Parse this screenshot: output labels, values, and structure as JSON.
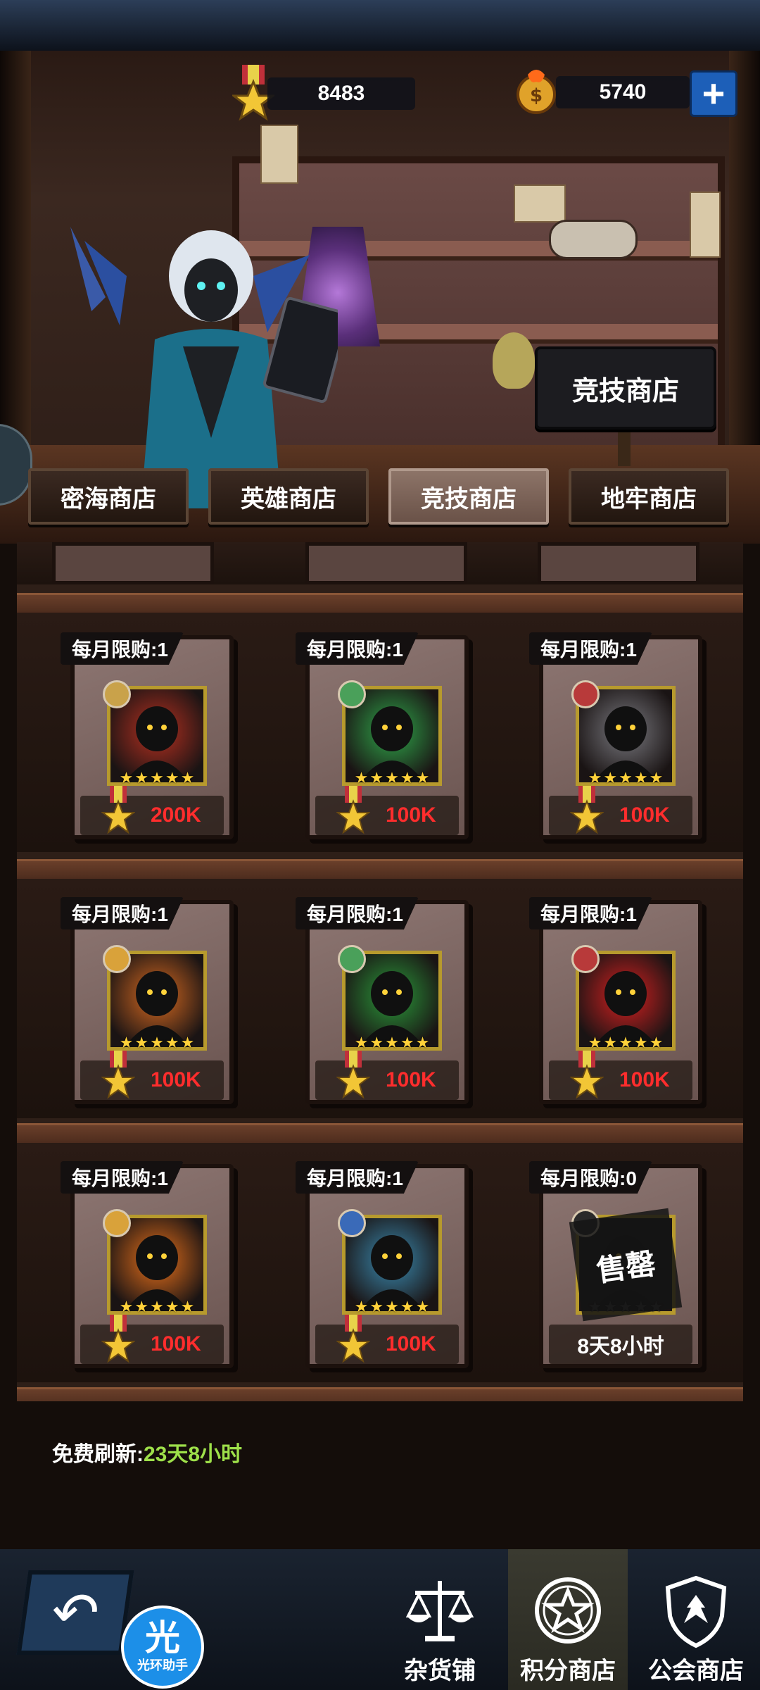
{
  "currency": {
    "arena_points": "8483",
    "gold": "5740",
    "add_label": "+"
  },
  "banner": {
    "sign_label": "竞技商店"
  },
  "tabs": [
    {
      "label": "密海商店"
    },
    {
      "label": "英雄商店"
    },
    {
      "label": "竞技商店",
      "active": true
    },
    {
      "label": "地牢商店"
    }
  ],
  "shop": {
    "items": [
      {
        "limit": "每月限购:1",
        "price": "200K",
        "element_color": "#c9a24a",
        "hero_color": "#b83020",
        "stars": 5
      },
      {
        "limit": "每月限购:1",
        "price": "100K",
        "element_color": "#4aa05a",
        "hero_color": "#2fa84a",
        "stars": 5
      },
      {
        "limit": "每月限购:1",
        "price": "100K",
        "element_color": "#b83a3a",
        "hero_color": "#7a7a80",
        "stars": 5
      },
      {
        "limit": "每月限购:1",
        "price": "100K",
        "element_color": "#d9a23a",
        "hero_color": "#d86a20",
        "stars": 5
      },
      {
        "limit": "每月限购:1",
        "price": "100K",
        "element_color": "#4aa05a",
        "hero_color": "#2a9a3a",
        "stars": 5
      },
      {
        "limit": "每月限购:1",
        "price": "100K",
        "element_color": "#b83a3a",
        "hero_color": "#d82020",
        "stars": 5
      },
      {
        "limit": "每月限购:1",
        "price": "100K",
        "element_color": "#d9a23a",
        "hero_color": "#e8701a",
        "stars": 5
      },
      {
        "limit": "每月限购:1",
        "price": "100K",
        "element_color": "#3a6ab8",
        "hero_color": "#3a8ab0",
        "stars": 5
      },
      {
        "limit": "每月限购:0",
        "sold_out": "售罄",
        "time": "8天8小时",
        "element_color": "#2a2a2a",
        "hero_color": "#1a1a1a",
        "stars": 5
      }
    ],
    "refresh_label": "免费刷新:",
    "refresh_time": "23天8小时"
  },
  "nav": {
    "items": [
      {
        "label": "杂货铺",
        "icon": "scales-icon"
      },
      {
        "label": "积分商店",
        "icon": "star-medal-icon",
        "active": true
      },
      {
        "label": "公会商店",
        "icon": "guild-shield-icon"
      }
    ],
    "helper_big": "光",
    "helper_small": "光环助手"
  },
  "colors": {
    "price_red": "#ff2d2d",
    "refresh_green": "#9ee04a",
    "plus_blue": "#1d5fb8"
  }
}
